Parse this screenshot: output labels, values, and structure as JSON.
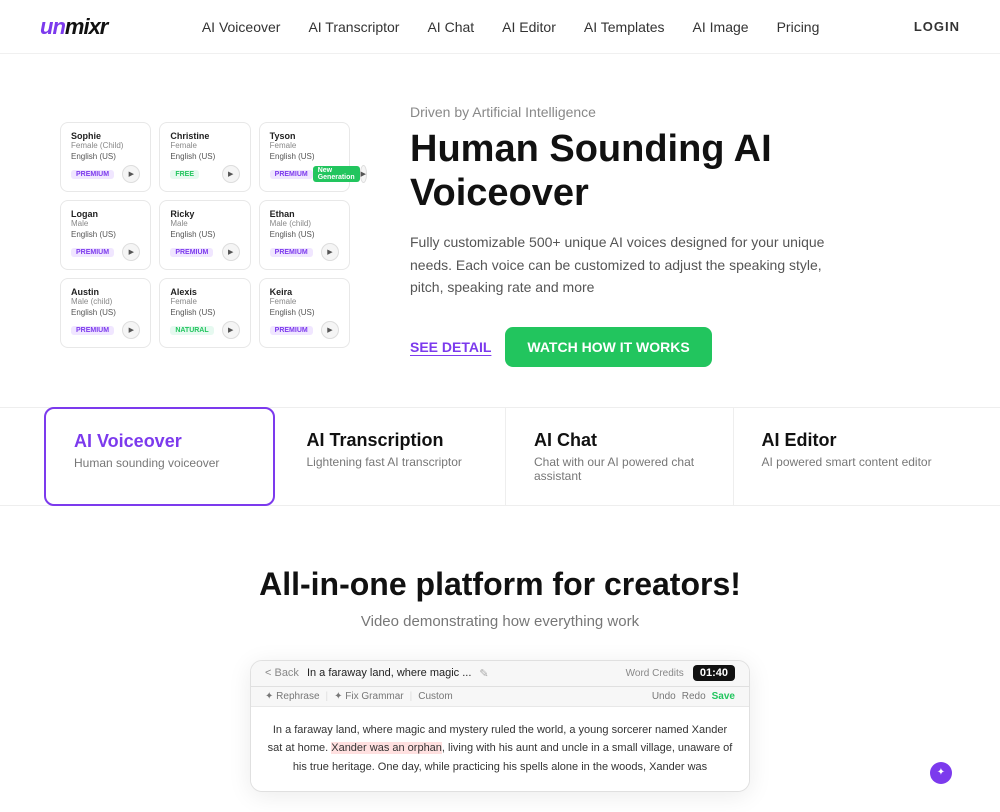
{
  "logo": {
    "text": "unmixr"
  },
  "nav": {
    "links": [
      {
        "label": "AI Voiceover",
        "href": "#"
      },
      {
        "label": "AI Transcriptor",
        "href": "#"
      },
      {
        "label": "AI Chat",
        "href": "#"
      },
      {
        "label": "AI Editor",
        "href": "#"
      },
      {
        "label": "AI Templates",
        "href": "#"
      },
      {
        "label": "AI Image",
        "href": "#"
      },
      {
        "label": "Pricing",
        "href": "#"
      }
    ],
    "login": "LOGIN"
  },
  "hero": {
    "driven": "Driven by Artificial Intelligence",
    "title": "Human Sounding AI Voiceover",
    "desc": "Fully customizable 500+ unique AI voices designed for your unique needs. Each voice can be customized to adjust the speaking style, pitch, speaking rate and more",
    "btn_detail": "SEE DETAIL",
    "btn_watch": "WATCH HOW IT WORKS"
  },
  "voices": [
    {
      "name": "Sophie",
      "gender": "Female (Child)",
      "lang": "English (US)",
      "badge": "premium",
      "badge_text": "PREMIUM"
    },
    {
      "name": "Christine",
      "gender": "Female",
      "lang": "English (US)",
      "badge": "free",
      "badge_text": "FREE",
      "extra": ""
    },
    {
      "name": "Tyson",
      "gender": "Female",
      "lang": "English (US)",
      "badge": "premium",
      "badge_text": "PREMIUM",
      "extra2": "New Generation"
    },
    {
      "name": "Logan",
      "gender": "Male",
      "lang": "English (US)",
      "badge": "premium",
      "badge_text": "PREMIUM"
    },
    {
      "name": "Ricky",
      "gender": "Male",
      "lang": "English (US)",
      "badge": "premium",
      "badge_text": "PREMIUM"
    },
    {
      "name": "Ethan",
      "gender": "Male (child)",
      "lang": "English (US)",
      "badge": "premium",
      "badge_text": "PREMIUM"
    },
    {
      "name": "Austin",
      "gender": "Male (child)",
      "lang": "English (US)",
      "badge": "premium",
      "badge_text": "PREMIUM"
    },
    {
      "name": "Alexis",
      "gender": "Female",
      "lang": "English (US)",
      "badge": "free",
      "badge_text": "NATURAL"
    },
    {
      "name": "Keira",
      "gender": "Female",
      "lang": "English (US)",
      "badge": "premium",
      "badge_text": "PREMIUM"
    }
  ],
  "features": [
    {
      "id": "voiceover",
      "title": "AI Voiceover",
      "desc": "Human sounding voiceover",
      "active": true
    },
    {
      "id": "transcription",
      "title": "AI Transcription",
      "desc": "Lightening fast AI transcriptor",
      "active": false
    },
    {
      "id": "chat",
      "title": "AI Chat",
      "desc": "Chat with our AI powered chat assistant",
      "active": false
    },
    {
      "id": "editor",
      "title": "AI Editor",
      "desc": "AI powered smart content editor",
      "active": false
    }
  ],
  "platform": {
    "title": "All-in-one platform for creators!",
    "desc": "Video demonstrating how everything work"
  },
  "editor_preview": {
    "back": "< Back",
    "filename": "In a faraway land, where magic ...",
    "timer": "01:40",
    "word_credits": "Word Credits",
    "undo": "Undo",
    "redo": "Redo",
    "save": "Save",
    "rephrase": "✦ Rephrase",
    "fix_grammar": "✦ Fix Grammar",
    "custom": "Custom",
    "body": "In a faraway land, where magic and mystery ruled the world, a young sorcerer named Xander sat at home. Xander was an orphan, living with his aunt and uncle in a small village, unaware of his true heritage. One day, while practicing his spells alone in the woods, Xander was"
  }
}
